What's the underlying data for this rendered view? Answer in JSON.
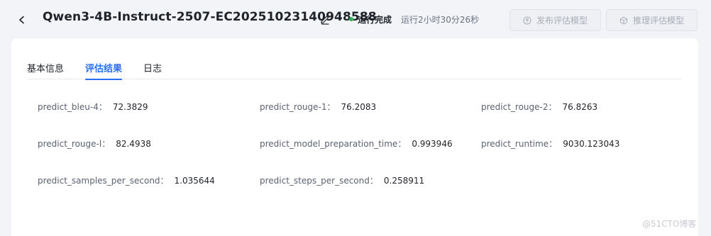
{
  "header": {
    "title": "Qwen3-4B-Instruct-2507-EC20251023140948588",
    "status": "运行完成",
    "duration": "运行2小时30分26秒",
    "publish_button": "发布评估模型",
    "infer_button": "推理评估模型",
    "status_color": "#2fb45a"
  },
  "tabs": [
    {
      "label": "基本信息",
      "active": false
    },
    {
      "label": "评估结果",
      "active": true
    },
    {
      "label": "日志",
      "active": false
    }
  ],
  "metrics": [
    {
      "label": "predict_bleu-4：",
      "value": "72.3829"
    },
    {
      "label": "predict_rouge-1：",
      "value": "76.2083"
    },
    {
      "label": "predict_rouge-2：",
      "value": "76.8263"
    },
    {
      "label": "predict_rouge-l：",
      "value": "82.4938"
    },
    {
      "label": "predict_model_preparation_time：",
      "value": "0.993946"
    },
    {
      "label": "predict_runtime：",
      "value": "9030.123043"
    },
    {
      "label": "predict_samples_per_second：",
      "value": "1.035644"
    },
    {
      "label": "predict_steps_per_second：",
      "value": "0.258911"
    }
  ],
  "watermark": "@51CTO博客",
  "colors": {
    "accent": "#2b6ef6",
    "background": "#f3f4f8"
  }
}
